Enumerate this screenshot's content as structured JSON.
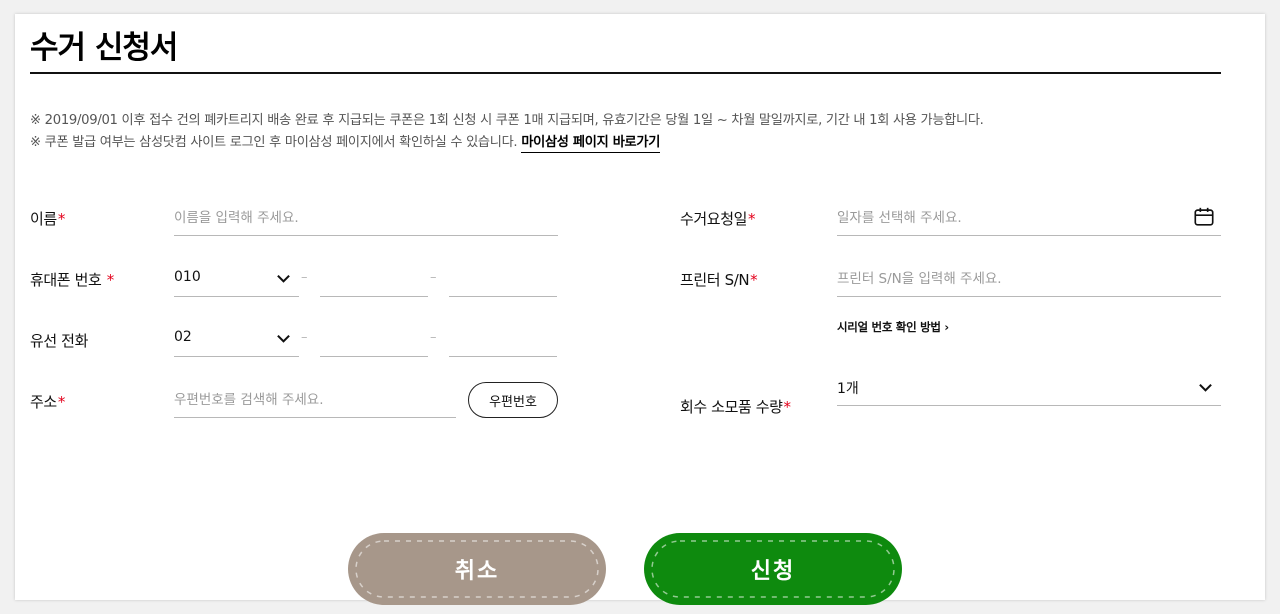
{
  "page": {
    "title": "수거 신청서"
  },
  "notices": {
    "line1": "※ 2019/09/01 이후 접수 건의 폐카트리지 배송 완료 후 지급되는 쿠폰은 1회 신청 시 쿠폰 1매 지급되며, 유효기간은 당월 1일 ~ 차월 말일까지로, 기간 내 1회 사용 가능합니다.",
    "line2": "※ 쿠폰 발급 여부는 삼성닷컴 사이트 로그인 후 마이삼성 페이지에서 확인하실 수 있습니다.",
    "link": "마이삼성 페이지 바로가기"
  },
  "form": {
    "name": {
      "label": "이름",
      "required": "*",
      "placeholder": "이름을 입력해 주세요."
    },
    "mobile": {
      "label": "휴대폰 번호",
      "required": "*",
      "prefix": "010",
      "dash": "–"
    },
    "phone": {
      "label": "유선 전화",
      "prefix": "02",
      "dash": "–"
    },
    "address": {
      "label": "주소",
      "required": "*",
      "placeholder": "우편번호를 검색해 주세요.",
      "button": "우편번호"
    },
    "pickup_date": {
      "label": "수거요청일",
      "required": "*",
      "placeholder": "일자를 선택해 주세요."
    },
    "printer_sn": {
      "label": "프린터 S/N",
      "required": "*",
      "placeholder": "프린터 S/N을 입력해 주세요.",
      "help_link": "시리얼 번호 확인 방법 ›"
    },
    "quantity": {
      "label": "회수 소모품 수량",
      "required": "*",
      "value": "1개"
    }
  },
  "actions": {
    "cancel": "취소",
    "submit": "신청"
  },
  "colors": {
    "cancel": "#a7978a",
    "submit": "#0e8a0e",
    "required": "#e3001b"
  }
}
